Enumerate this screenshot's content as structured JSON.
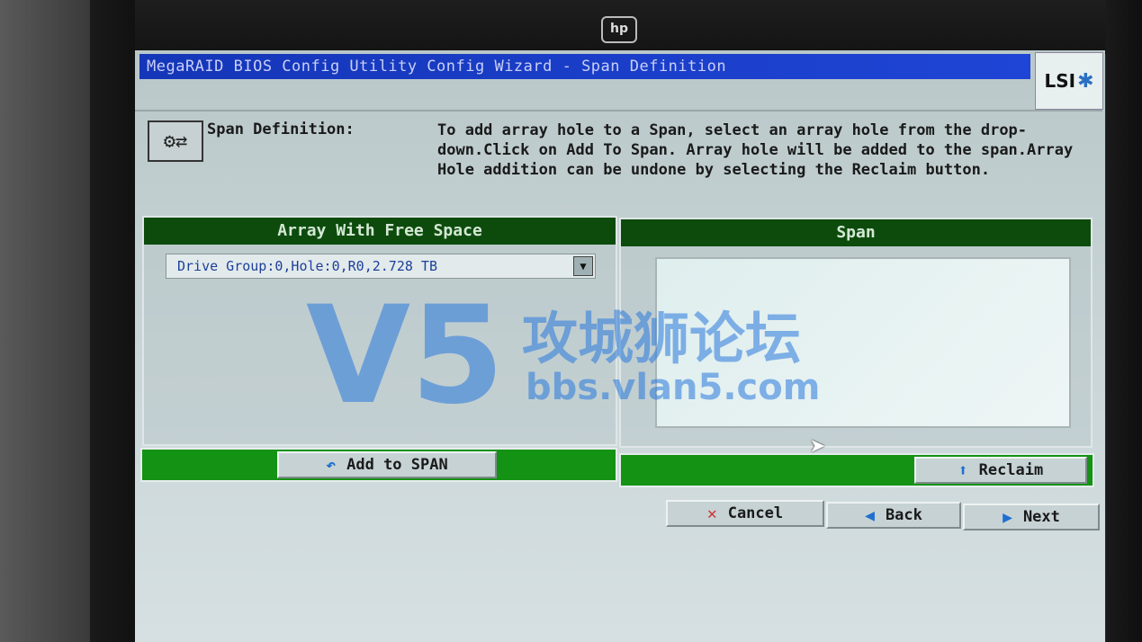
{
  "window": {
    "title": "MegaRAID BIOS Config Utility  Config Wizard - Span Definition",
    "brand": "LSI"
  },
  "bezel": {
    "logo": "hp"
  },
  "header": {
    "label": "Span Definition:",
    "instructions": "To add array hole to a Span, select an array hole from the drop-down.Click on Add To Span. Array hole will be added to the span.Array Hole addition can be undone by selecting the Reclaim button."
  },
  "left_panel": {
    "title": "Array With Free Space",
    "dropdown_value": "Drive Group:0,Hole:0,R0,2.728 TB",
    "add_button": "Add to SPAN"
  },
  "right_panel": {
    "title": "Span",
    "items": [],
    "reclaim_button": "Reclaim"
  },
  "nav": {
    "cancel": "Cancel",
    "back": "Back",
    "next": "Next"
  },
  "watermark": {
    "logo": "V5",
    "text_cn": "攻城狮论坛",
    "url": "bbs.vlan5.com"
  },
  "icons": {
    "wizard": "wizard-icon",
    "add": "undo-arrow-icon",
    "reclaim": "up-arrow-icon",
    "cancel": "x-icon",
    "back": "left-arrow-icon",
    "next": "right-arrow-icon"
  },
  "colors": {
    "title_bar": "#1f45d6",
    "panel_header": "#0d4b0d",
    "action_bar": "#149214"
  }
}
